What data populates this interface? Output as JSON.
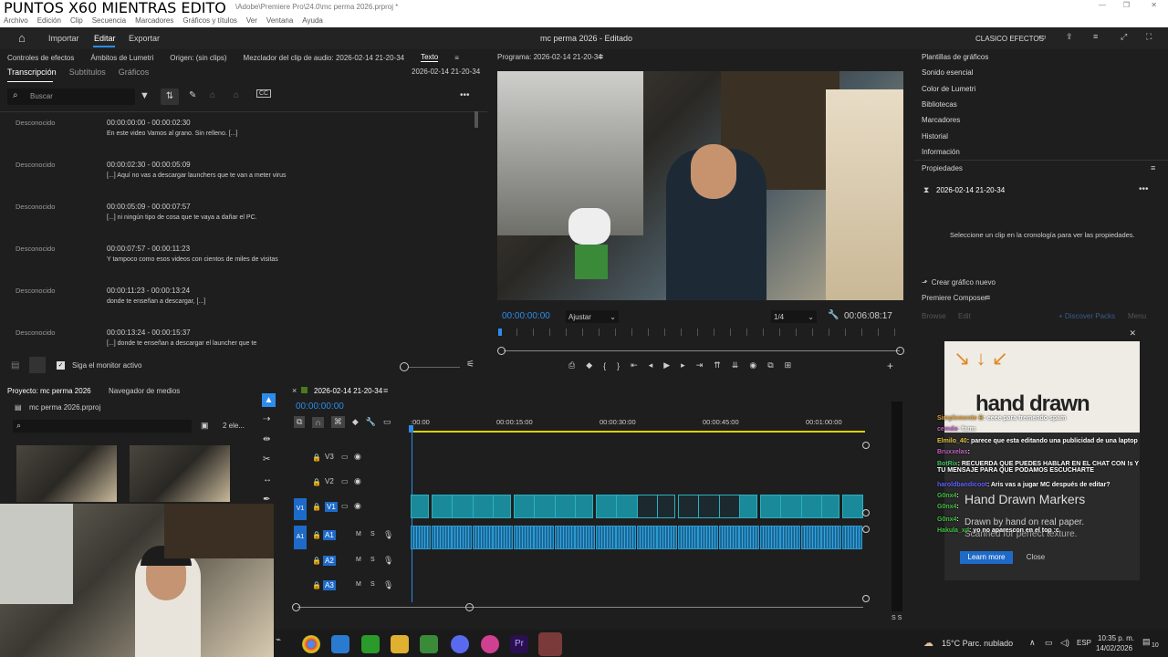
{
  "window": {
    "title": "\\Adobe\\Premiere Pro\\24.0\\mc perma 2026.prproj *",
    "stream_title": "PUNTOS X60 MIENTRAS EDITO"
  },
  "menu": [
    "Archivo",
    "Edición",
    "Clip",
    "Secuencia",
    "Marcadores",
    "Gráficos y títulos",
    "Ver",
    "Ventana",
    "Ayuda"
  ],
  "nav": {
    "tabs": [
      "Importar",
      "Editar",
      "Exportar"
    ],
    "project_title": "mc perma 2026 - Editado",
    "workspace": "CLASICO EFECTOS"
  },
  "left_panel": {
    "tabs": [
      "Controles de efectos",
      "Ámbitos de Lumetri",
      "Origen: (sin clips)",
      "Mezclador del clip de audio: 2026-02-14 21-20-34",
      "Texto"
    ],
    "subtabs": [
      "Transcripción",
      "Subtítulos",
      "Gráficos"
    ],
    "seq_name": "2026-02-14 21-20-34",
    "search_placeholder": "Buscar",
    "entries": [
      {
        "speaker": "Desconocido",
        "time": "00:00:00:00 - 00:00:02:30",
        "text": "En este video Vamos al grano. Sin relleno. [...]"
      },
      {
        "speaker": "Desconocido",
        "time": "00:00:02:30 - 00:00:05:09",
        "text": "[...] Aquí no vas a descargar launchers que te van a meter virus"
      },
      {
        "speaker": "Desconocido",
        "time": "00:00:05:09 - 00:00:07:57",
        "text": "[...] ni ningún tipo de cosa que te vaya a dañar el PC."
      },
      {
        "speaker": "Desconocido",
        "time": "00:00:07:57 - 00:00:11:23",
        "text": "Y tampoco como esos videos con cientos de miles de visitas"
      },
      {
        "speaker": "Desconocido",
        "time": "00:00:11:23 - 00:00:13:24",
        "text": "donde te enseñan a descargar, [...]"
      },
      {
        "speaker": "Desconocido",
        "time": "00:00:13:24 - 00:00:15:37",
        "text": "[...] donde te enseñan a descargar el launcher que te"
      }
    ],
    "follow_label": "Siga el monitor activo"
  },
  "program": {
    "title": "Programa: 2026-02-14 21-20-34",
    "timecode": "00:00:00:00",
    "fit": "Ajustar",
    "quality": "1/4",
    "duration": "00:06:08:17"
  },
  "right_panel": {
    "items": [
      "Plantillas de gráficos",
      "Sonido esencial",
      "Color de Lumetri",
      "Bibliotecas",
      "Marcadores",
      "Historial",
      "Información"
    ],
    "props_title": "Propiedades",
    "props_seq": "2026-02-14 21-20-34",
    "props_msg": "Seleccione un clip en la cronología para ver las propiedades.",
    "create_btn": "Crear gráfico nuevo",
    "composer": "Premiere Composer",
    "composer_tabs": [
      "Browse",
      "Edit"
    ],
    "discover": "+ Discover Packs",
    "menu_lbl": "Menu",
    "ad_title": "hand drawn",
    "ad_heading": "Hand Drawn Markers",
    "ad_line1": "Drawn by hand on real paper.",
    "ad_line2": "Scanned for perfect texture.",
    "learn": "Learn more",
    "close": "Close"
  },
  "chat": [
    {
      "user": "Simplemente B",
      "msg": ": eeee para tremendo spam",
      "color": "#e0a040"
    },
    {
      "user": "cemdo",
      "msg": ": farm",
      "color": "#c060c0"
    },
    {
      "user": "Elmilo_40",
      "msg": ": parece que esta editando una publicidad de una laptop",
      "color": "#e0c040"
    },
    {
      "user": "Bruxxelas",
      "msg": ":",
      "color": "#c060c0"
    },
    {
      "user": "BotRix",
      "msg": ": RECUERDA QUE PUEDES HABLAR EN EL CHAT CON !s Y TU MENSAJE PARA QUE PODAMOS ESCUCHARTE",
      "color": "#40c060"
    },
    {
      "user": "haroldbandicoot",
      "msg": ": Aris vas a jugar MC después de editar?",
      "color": "#6060ff"
    },
    {
      "user": "G0nx4",
      "msg": ":",
      "color": "#40c040"
    },
    {
      "user": "G0nx4",
      "msg": ":",
      "color": "#40c040"
    },
    {
      "user": "G0nx4",
      "msg": ":",
      "color": "#40c040"
    },
    {
      "user": "Hakula_xd",
      "msg": ": yo no aparescon en el top :c",
      "color": "#40c040"
    }
  ],
  "project": {
    "tab1": "Proyecto: mc perma 2026",
    "tab2": "Navegador de medios",
    "file": "mc perma 2026.prproj",
    "count": "2 ele..."
  },
  "timeline": {
    "seq": "2026-02-14 21-20-34",
    "timecode": "00:00:00:00",
    "ticks": [
      ":00:00",
      "00:00:15:00",
      "00:00:30:00",
      "00:00:45:00",
      "00:01:00:00"
    ],
    "tracks_v": [
      "V3",
      "V2",
      "V1"
    ],
    "tracks_a": [
      "A1",
      "A2",
      "A3"
    ]
  },
  "taskbar": {
    "weather": "15°C Parc. nublado",
    "lang": "ESP",
    "time": "10:35 p. m.",
    "date": "14/02/2026",
    "notif": "10"
  },
  "colors": {
    "accent": "#2d8ceb",
    "timeline_yellow": "#e0d000",
    "clip_video": "#1a8a9a",
    "clip_audio": "#186a96"
  }
}
